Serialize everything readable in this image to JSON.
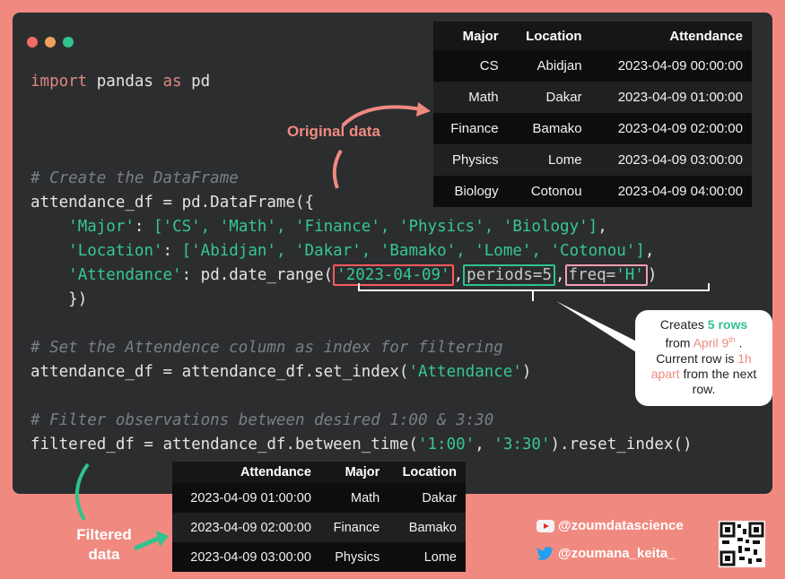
{
  "window": {
    "dots": [
      {
        "name": "close",
        "color": "#f26b64"
      },
      {
        "name": "minimize",
        "color": "#f2a15a"
      },
      {
        "name": "maximize",
        "color": "#31c48d"
      }
    ]
  },
  "code": {
    "line1_kw1": "import",
    "line1_mod": " pandas ",
    "line1_kw2": "as",
    "line1_alias": " pd",
    "comment1": "# Create the DataFrame",
    "line_df": "attendance_df = pd.DataFrame({",
    "major_key": "'Major'",
    "major_vals": "['CS', 'Math', 'Finance', 'Physics', 'Biology']",
    "loc_key": "'Location'",
    "loc_vals": "['Abidjan', 'Dakar', 'Bamako', 'Lome', 'Cotonou']",
    "att_key": "'Attendance'",
    "att_call": ": pd.date_range(",
    "start_arg": "'2023-04-09'",
    "periods_arg": "periods=5",
    "freq_label": "freq=",
    "freq_val": "'H'",
    "close_line": "})",
    "comment2": "# Set the Attendence column as index for filtering",
    "set_index_pre": "attendance_df = attendance_df.set_index(",
    "set_index_arg": "'Attendance'",
    "comment3": "# Filter observations between desired 1:00 & 3:30",
    "filter_pre": "filtered_df = attendance_df.between_time(",
    "filter_a": "'1:00'",
    "filter_b": "'3:30'",
    "filter_post": ").reset_index()"
  },
  "original_table": {
    "headers": [
      "Major",
      "Location",
      "Attendance"
    ],
    "rows": [
      [
        "CS",
        "Abidjan",
        "2023-04-09 00:00:00"
      ],
      [
        "Math",
        "Dakar",
        "2023-04-09 01:00:00"
      ],
      [
        "Finance",
        "Bamako",
        "2023-04-09 02:00:00"
      ],
      [
        "Physics",
        "Lome",
        "2023-04-09 03:00:00"
      ],
      [
        "Biology",
        "Cotonou",
        "2023-04-09 04:00:00"
      ]
    ]
  },
  "filtered_table": {
    "headers": [
      "Attendance",
      "Major",
      "Location"
    ],
    "rows": [
      [
        "2023-04-09 01:00:00",
        "Math",
        "Dakar"
      ],
      [
        "2023-04-09 02:00:00",
        "Finance",
        "Bamako"
      ],
      [
        "2023-04-09 03:00:00",
        "Physics",
        "Lome"
      ]
    ]
  },
  "labels": {
    "original": "Original data",
    "filtered_1": "Filtered",
    "filtered_2": "data"
  },
  "callout": {
    "t1": "Creates ",
    "t2": "5 rows",
    "t3": "from ",
    "t4": "April 9",
    "t4_sup": "th",
    "t5": " .",
    "t6": "Current row is ",
    "t7": "1h",
    "t8": "apart",
    "t9": " from the next",
    "t10": "row."
  },
  "social": {
    "youtube": "@zoumdatascience",
    "twitter": "@zoumana_keita_"
  },
  "icons": {
    "youtube": "youtube-icon",
    "twitter": "twitter-icon",
    "qr": "qr-code-icon"
  }
}
